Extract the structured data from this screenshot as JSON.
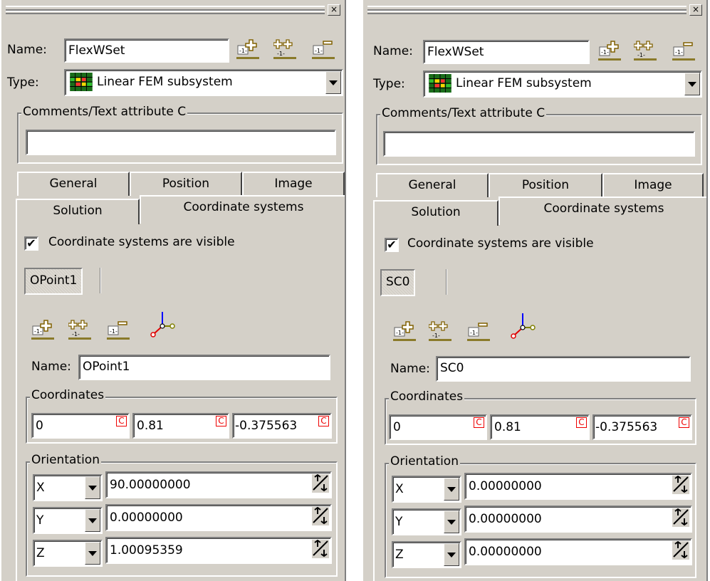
{
  "close_glyph": "×",
  "panels": [
    {
      "name_label": "Name:",
      "name_value": "FlexWSet",
      "type_label": "Type:",
      "type_value": "Linear FEM subsystem",
      "comments_title": "Comments/Text attribute C",
      "comments_value": "",
      "tabs": {
        "general": "General",
        "position": "Position",
        "image": "Image",
        "solution": "Solution",
        "coord": "Coordinate systems"
      },
      "visible_label": "Coordinate systems are visible",
      "visible_checked": "✔",
      "cs_tab": "OPoint1",
      "cs_name_label": "Name:",
      "cs_name_value": "OPoint1",
      "coords_title": "Coordinates",
      "coords": [
        "0",
        "0.81",
        "-0.375563"
      ],
      "c_mark": "C",
      "orient_title": "Orientation",
      "orient": [
        {
          "axis": "X",
          "value": "90.00000000"
        },
        {
          "axis": "Y",
          "value": "0.00000000"
        },
        {
          "axis": "Z",
          "value": "1.00095359"
        }
      ]
    },
    {
      "name_label": "Name:",
      "name_value": "FlexWSet",
      "type_label": "Type:",
      "type_value": "Linear FEM subsystem",
      "comments_title": "Comments/Text attribute C",
      "comments_value": "",
      "tabs": {
        "general": "General",
        "position": "Position",
        "image": "Image",
        "solution": "Solution",
        "coord": "Coordinate systems"
      },
      "visible_label": "Coordinate systems are visible",
      "visible_checked": "✔",
      "cs_tab": "SC0",
      "cs_name_label": "Name:",
      "cs_name_value": "SC0",
      "coords_title": "Coordinates",
      "coords": [
        "0",
        "0.81",
        "-0.375563"
      ],
      "c_mark": "C",
      "orient_title": "Orientation",
      "orient": [
        {
          "axis": "X",
          "value": "0.00000000"
        },
        {
          "axis": "Y",
          "value": "0.00000000"
        },
        {
          "axis": "Z",
          "value": "0.00000000"
        }
      ]
    }
  ]
}
